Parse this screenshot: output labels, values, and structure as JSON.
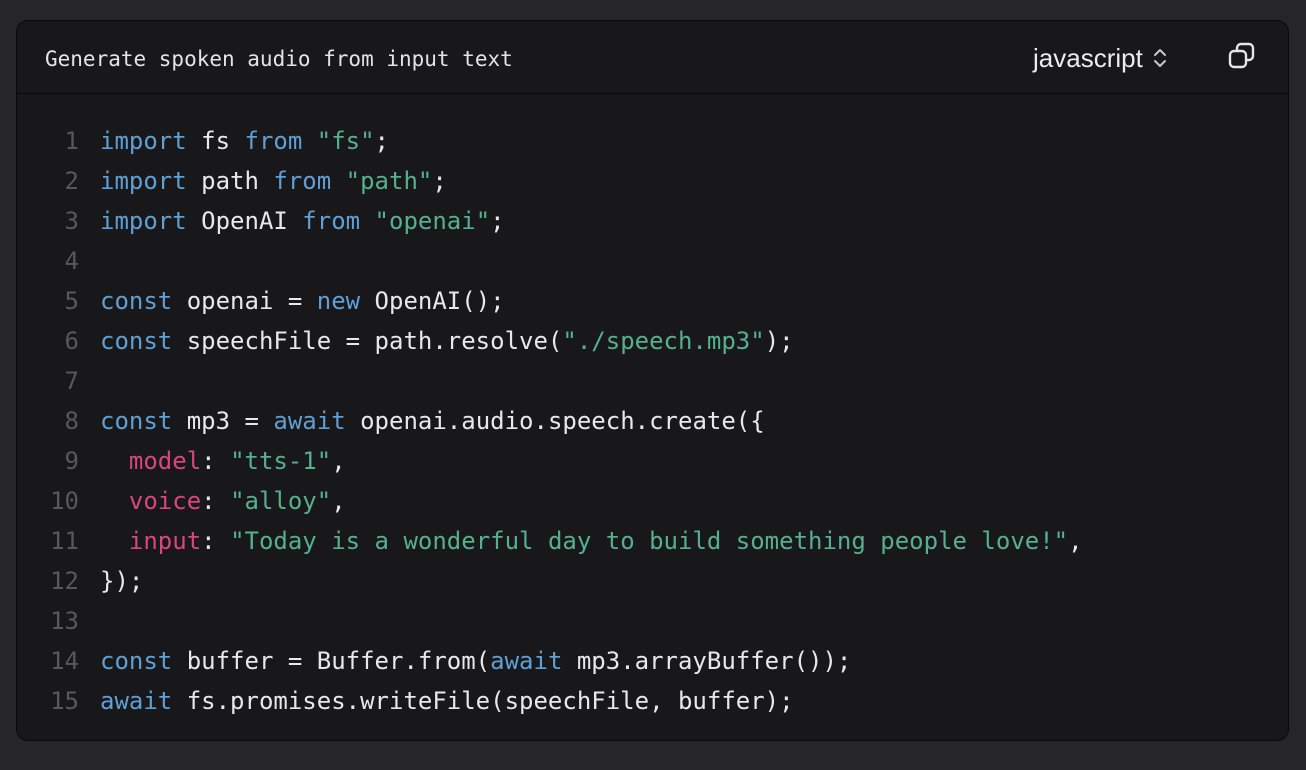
{
  "header": {
    "title": "Generate spoken audio from input text",
    "language": "javascript"
  },
  "icons": {
    "language_dropdown": "chevron-up-down-icon",
    "copy": "copy-icon"
  },
  "colors": {
    "background": "#262628",
    "panel": "#18181b",
    "keyword": "#5e9fd6",
    "string": "#55b08d",
    "property": "#d9467a",
    "text": "#e8e8ea",
    "line_number": "#57575c"
  },
  "code": {
    "lines": [
      {
        "n": "1",
        "tokens": [
          [
            "kw",
            "import"
          ],
          [
            "plain",
            " fs "
          ],
          [
            "kw",
            "from"
          ],
          [
            "plain",
            " "
          ],
          [
            "str",
            "\"fs\""
          ],
          [
            "plain",
            ";"
          ]
        ]
      },
      {
        "n": "2",
        "tokens": [
          [
            "kw",
            "import"
          ],
          [
            "plain",
            " path "
          ],
          [
            "kw",
            "from"
          ],
          [
            "plain",
            " "
          ],
          [
            "str",
            "\"path\""
          ],
          [
            "plain",
            ";"
          ]
        ]
      },
      {
        "n": "3",
        "tokens": [
          [
            "kw",
            "import"
          ],
          [
            "plain",
            " OpenAI "
          ],
          [
            "kw",
            "from"
          ],
          [
            "plain",
            " "
          ],
          [
            "str",
            "\"openai\""
          ],
          [
            "plain",
            ";"
          ]
        ]
      },
      {
        "n": "4",
        "tokens": []
      },
      {
        "n": "5",
        "tokens": [
          [
            "kw",
            "const"
          ],
          [
            "plain",
            " openai = "
          ],
          [
            "kw",
            "new"
          ],
          [
            "plain",
            " OpenAI();"
          ]
        ]
      },
      {
        "n": "6",
        "tokens": [
          [
            "kw",
            "const"
          ],
          [
            "plain",
            " speechFile = path.resolve("
          ],
          [
            "str",
            "\"./speech.mp3\""
          ],
          [
            "plain",
            ");"
          ]
        ]
      },
      {
        "n": "7",
        "tokens": []
      },
      {
        "n": "8",
        "tokens": [
          [
            "kw",
            "const"
          ],
          [
            "plain",
            " mp3 = "
          ],
          [
            "kw",
            "await"
          ],
          [
            "plain",
            " openai.audio.speech.create({"
          ]
        ]
      },
      {
        "n": "9",
        "tokens": [
          [
            "plain",
            "  "
          ],
          [
            "prop",
            "model"
          ],
          [
            "plain",
            ": "
          ],
          [
            "str",
            "\"tts-1\""
          ],
          [
            "plain",
            ","
          ]
        ]
      },
      {
        "n": "10",
        "tokens": [
          [
            "plain",
            "  "
          ],
          [
            "prop",
            "voice"
          ],
          [
            "plain",
            ": "
          ],
          [
            "str",
            "\"alloy\""
          ],
          [
            "plain",
            ","
          ]
        ]
      },
      {
        "n": "11",
        "tokens": [
          [
            "plain",
            "  "
          ],
          [
            "prop",
            "input"
          ],
          [
            "plain",
            ": "
          ],
          [
            "str",
            "\"Today is a wonderful day to build something people love!\""
          ],
          [
            "plain",
            ","
          ]
        ]
      },
      {
        "n": "12",
        "tokens": [
          [
            "plain",
            "});"
          ]
        ]
      },
      {
        "n": "13",
        "tokens": []
      },
      {
        "n": "14",
        "tokens": [
          [
            "kw",
            "const"
          ],
          [
            "plain",
            " buffer = Buffer.from("
          ],
          [
            "kw",
            "await"
          ],
          [
            "plain",
            " mp3.arrayBuffer());"
          ]
        ]
      },
      {
        "n": "15",
        "tokens": [
          [
            "kw",
            "await"
          ],
          [
            "plain",
            " fs.promises.writeFile(speechFile, buffer);"
          ]
        ]
      }
    ]
  }
}
